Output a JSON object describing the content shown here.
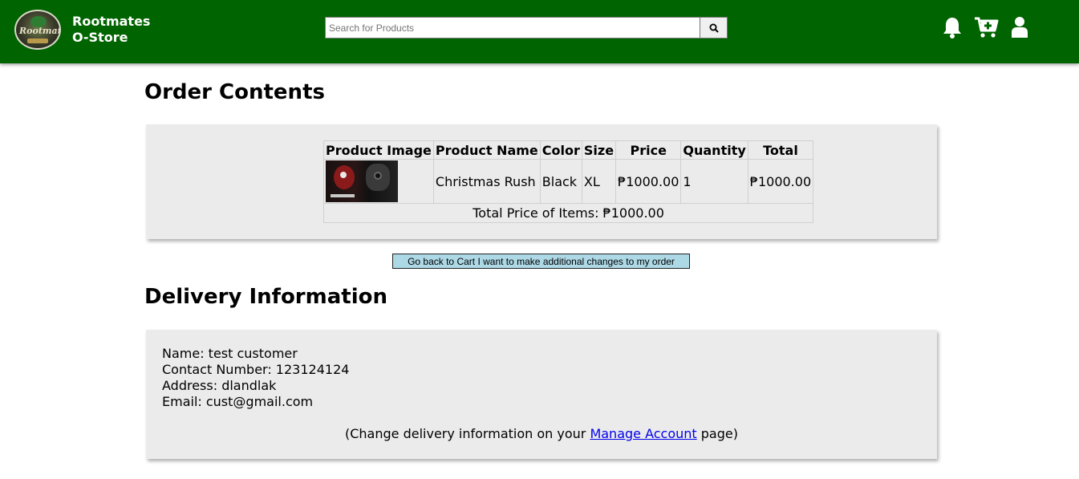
{
  "header": {
    "logo_text": "Rootmates",
    "brand_line1": "Rootmates",
    "brand_line2": "O-Store",
    "search_placeholder": "Search for Products",
    "icons": [
      "bell-icon",
      "cart-plus-icon",
      "user-icon"
    ],
    "bg_color": "#006400"
  },
  "order": {
    "heading": "Order Contents",
    "columns": [
      "Product Image",
      "Product Name",
      "Color",
      "Size",
      "Price",
      "Quantity",
      "Total"
    ],
    "items": [
      {
        "image": "Christmas Rush product image",
        "name": "Christmas Rush",
        "color": "Black",
        "size": "XL",
        "price": "₱1000.00",
        "quantity": "1",
        "total": "₱1000.00"
      }
    ],
    "total_label": "Total Price of Items: ₱1000.00",
    "back_button": "Go back to Cart I want to make additional changes to my order"
  },
  "delivery": {
    "heading": "Delivery Information",
    "name": "Name: test customer",
    "contact": "Contact Number: 123124124",
    "address": "Address: dlandlak",
    "email": "Email: cust@gmail.com",
    "note_before": "(Change delivery information on your ",
    "note_link": "Manage Account",
    "note_after": " page)"
  }
}
